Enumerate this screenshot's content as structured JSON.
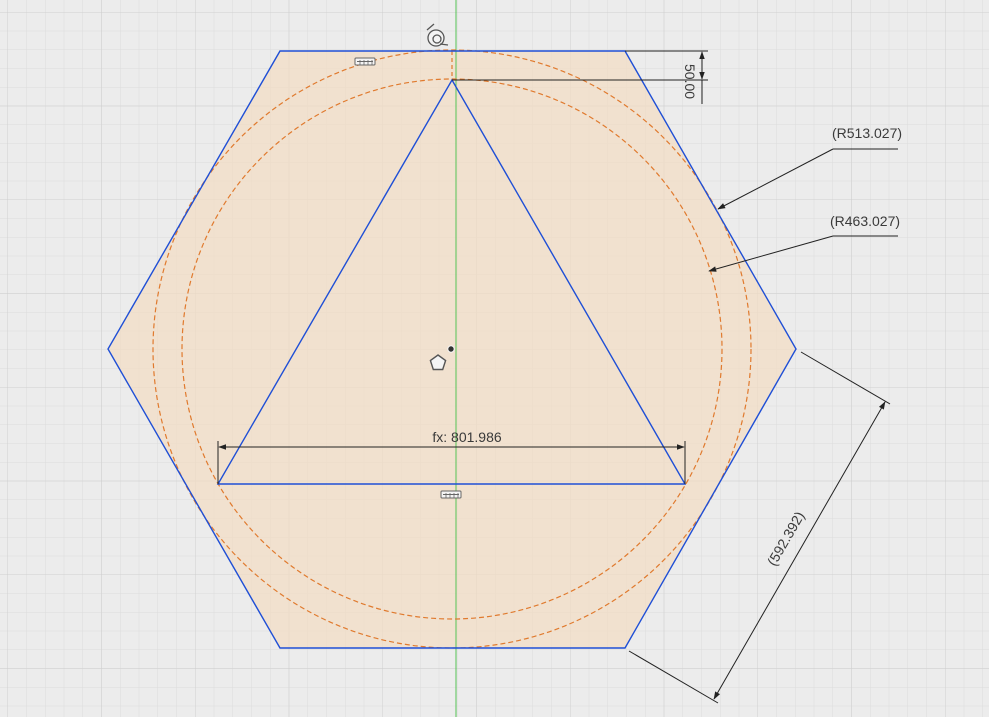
{
  "colors": {
    "background": "#ececec",
    "grid_minor": "#dcdcdc",
    "grid_major": "#cfcfcf",
    "profile_fill": "#f2dcc4",
    "sketch_line": "#1f4fd6",
    "construction_circle": "#e07a2e",
    "axis_line": "#55c255",
    "dimension": "#222222",
    "dimension_text": "#3a3a3a"
  },
  "dimensions": {
    "top_offset": "50.00",
    "outer_radius": "(R513.027)",
    "inner_radius": "(R463.027)",
    "triangle_width": "fx: 801.986",
    "hexagon_side": "(592.392)"
  },
  "icons": {
    "top_constraint": "horizontal-constraint-icon",
    "bottom_constraint": "horizontal-constraint-icon",
    "origin_marker": "pentagon-origin-icon",
    "coincident_marker": "coincident-icon"
  }
}
